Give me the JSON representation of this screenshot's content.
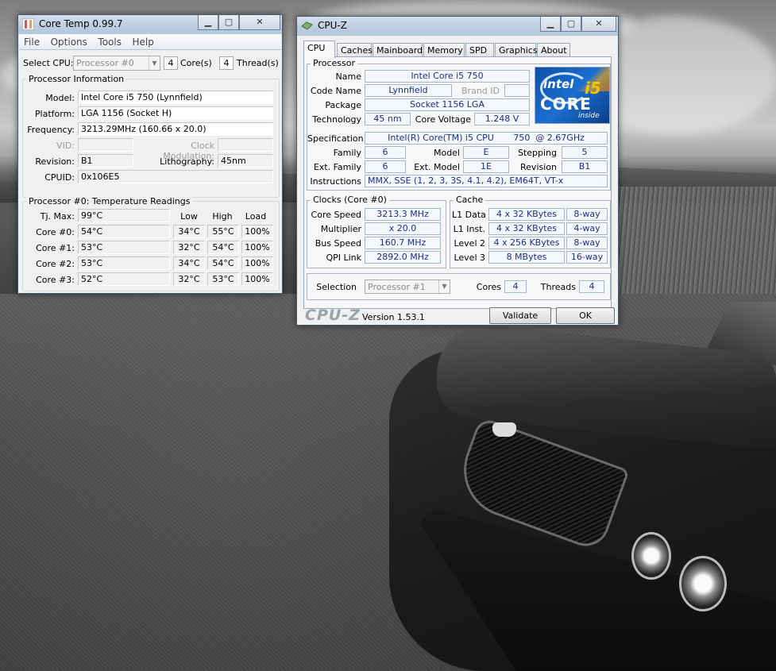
{
  "coretemp": {
    "title": "Core Temp 0.99.7",
    "menu": [
      "File",
      "Options",
      "Tools",
      "Help"
    ],
    "select_cpu_label": "Select CPU:",
    "select_cpu_value": "Processor #0",
    "cores_count": "4",
    "cores_label": "Core(s)",
    "threads_count": "4",
    "threads_label": "Thread(s)",
    "processor_info_title": "Processor Information",
    "info": {
      "model_label": "Model:",
      "model": "Intel Core i5 750 (Lynnfield)",
      "platform_label": "Platform:",
      "platform": "LGA 1156 (Socket H)",
      "frequency_label": "Frequency:",
      "frequency": "3213.29MHz (160.66 x 20.0)",
      "vid_label": "VID:",
      "vid": "",
      "clock_mod_label": "Clock Modulation:",
      "clock_mod": "",
      "revision_label": "Revision:",
      "revision": "B1",
      "lithography_label": "Lithography:",
      "lithography": "45nm",
      "cpuid_label": "CPUID:",
      "cpuid": "0x106E5"
    },
    "temps_title": "Processor #0: Temperature Readings",
    "temps_headers": {
      "low": "Low",
      "high": "High",
      "load": "Load"
    },
    "tjmax_label": "Tj. Max:",
    "tjmax": "99°C",
    "cores": [
      {
        "label": "Core #0:",
        "temp": "54°C",
        "low": "34°C",
        "high": "55°C",
        "load": "100%"
      },
      {
        "label": "Core #1:",
        "temp": "53°C",
        "low": "32°C",
        "high": "54°C",
        "load": "100%"
      },
      {
        "label": "Core #2:",
        "temp": "53°C",
        "low": "34°C",
        "high": "54°C",
        "load": "100%"
      },
      {
        "label": "Core #3:",
        "temp": "52°C",
        "low": "32°C",
        "high": "53°C",
        "load": "100%"
      }
    ]
  },
  "cpuz": {
    "title": "CPU-Z",
    "tabs": [
      "CPU",
      "Caches",
      "Mainboard",
      "Memory",
      "SPD",
      "Graphics",
      "About"
    ],
    "processor_group": "Processor",
    "name_label": "Name",
    "name": "Intel Core i5 750",
    "codename_label": "Code Name",
    "codename": "Lynnfield",
    "brandid_label": "Brand ID",
    "brandid": "",
    "package_label": "Package",
    "package": "Socket 1156 LGA",
    "technology_label": "Technology",
    "technology": "45 nm",
    "corevoltage_label": "Core Voltage",
    "corevoltage": "1.248 V",
    "spec_label": "Specification",
    "spec": "Intel(R) Core(TM) i5 CPU       750  @ 2.67GHz",
    "family_label": "Family",
    "family": "6",
    "model_label": "Model",
    "model": "E",
    "stepping_label": "Stepping",
    "stepping": "5",
    "extfamily_label": "Ext. Family",
    "extfamily": "6",
    "extmodel_label": "Ext. Model",
    "extmodel": "1E",
    "revision_label": "Revision",
    "revision": "B1",
    "instructions_label": "Instructions",
    "instructions": "MMX, SSE (1, 2, 3, 3S, 4.1, 4.2), EM64T, VT-x",
    "logo": {
      "intel": "intel",
      "core": "CORE",
      "i5": "i5",
      "inside": "inside"
    },
    "clocks_group": "Clocks (Core #0)",
    "corespeed_label": "Core Speed",
    "corespeed": "3213.3 MHz",
    "multiplier_label": "Multiplier",
    "multiplier": "x 20.0",
    "busspeed_label": "Bus Speed",
    "busspeed": "160.7 MHz",
    "qpilink_label": "QPI Link",
    "qpilink": "2892.0 MHz",
    "cache_group": "Cache",
    "cache": [
      {
        "label": "L1 Data",
        "size": "4 x 32 KBytes",
        "way": "8-way"
      },
      {
        "label": "L1 Inst.",
        "size": "4 x 32 KBytes",
        "way": "4-way"
      },
      {
        "label": "Level 2",
        "size": "4 x 256 KBytes",
        "way": "8-way"
      },
      {
        "label": "Level 3",
        "size": "8 MBytes",
        "way": "16-way"
      }
    ],
    "selection_label": "Selection",
    "selection": "Processor #1",
    "cores_label": "Cores",
    "cores": "4",
    "threads_label": "Threads",
    "threads": "4",
    "brand": "CPU-Z",
    "version": "Version 1.53.1",
    "validate_label": "Validate",
    "ok_label": "OK"
  }
}
